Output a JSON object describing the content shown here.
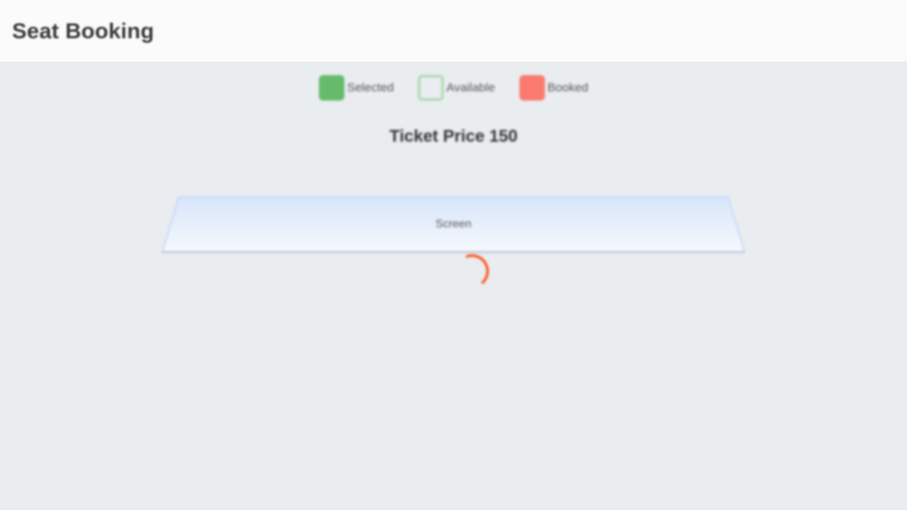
{
  "header": {
    "title": "Seat Booking"
  },
  "legend": {
    "items": [
      {
        "key": "selected",
        "label": "Selected",
        "color": "#66bb6a"
      },
      {
        "key": "available",
        "label": "Available",
        "color": "#a5d6a7"
      },
      {
        "key": "booked",
        "label": "Booked",
        "color": "#fa7a6e"
      }
    ]
  },
  "ticket": {
    "price_text": "Ticket Price 150"
  },
  "screen": {
    "label": "Screen"
  },
  "loading": {
    "icon": "loading-spinner-icon",
    "color": "#ff4d12"
  }
}
